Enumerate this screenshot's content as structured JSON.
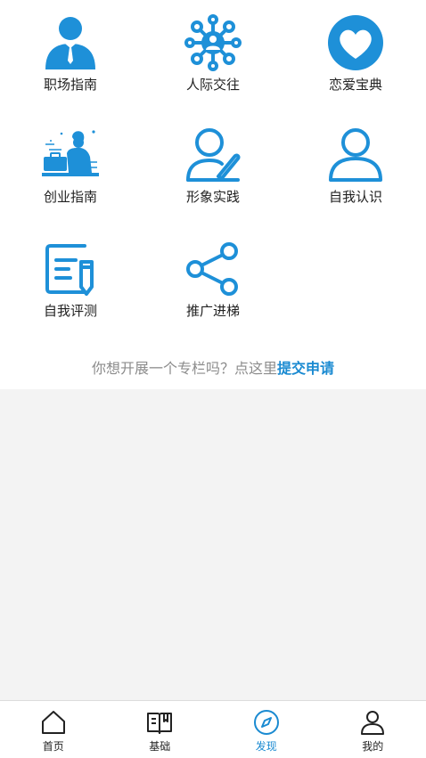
{
  "grid": {
    "items": [
      {
        "label": "职场指南",
        "icon": "business-person-icon"
      },
      {
        "label": "人际交往",
        "icon": "network-icon"
      },
      {
        "label": "恋爱宝典",
        "icon": "heart-icon"
      },
      {
        "label": "创业指南",
        "icon": "entrepreneur-icon"
      },
      {
        "label": "形象实践",
        "icon": "person-pen-icon"
      },
      {
        "label": "自我认识",
        "icon": "user-icon"
      },
      {
        "label": "自我评测",
        "icon": "document-edit-icon"
      },
      {
        "label": "推广进梯",
        "icon": "share-icon"
      }
    ]
  },
  "submit": {
    "prompt": "你想开展一个专栏吗？点这里",
    "link_label": "提交申请"
  },
  "tabbar": {
    "items": [
      {
        "label": "首页",
        "icon": "home-icon",
        "active": false
      },
      {
        "label": "基础",
        "icon": "book-icon",
        "active": false
      },
      {
        "label": "发现",
        "icon": "compass-icon",
        "active": true
      },
      {
        "label": "我的",
        "icon": "profile-icon",
        "active": false
      }
    ]
  },
  "colors": {
    "accent": "#1a8ad1",
    "icon_blue": "#1e90d8",
    "background": "#f3f3f3"
  }
}
